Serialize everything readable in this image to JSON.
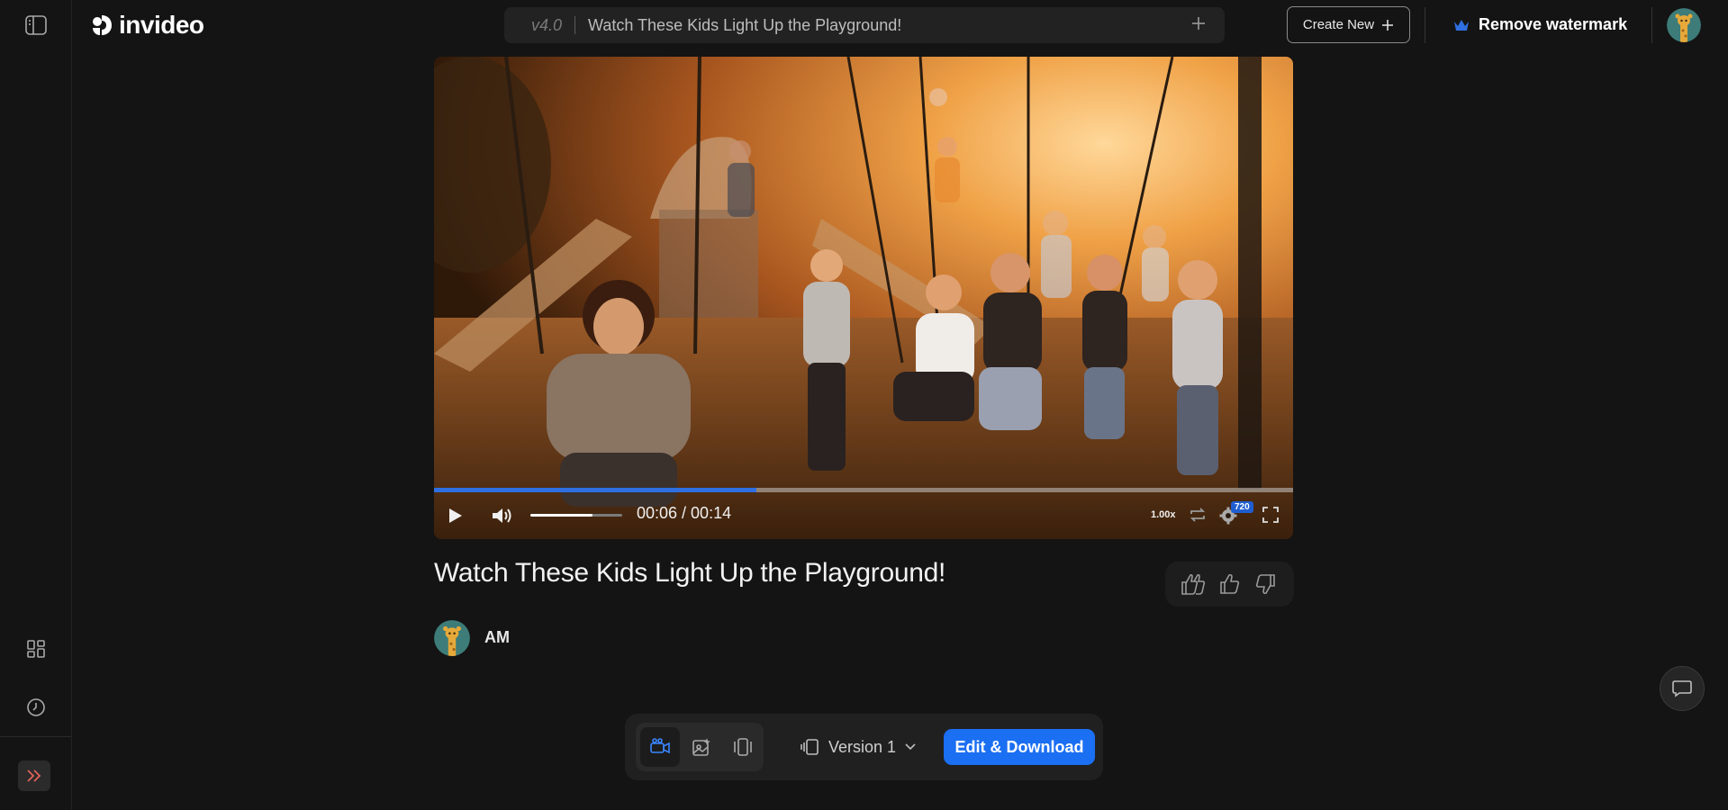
{
  "header": {
    "logo_text": "invideo",
    "version_label": "v4.0",
    "project_title": "Watch These Kids Light Up the Playground!",
    "create_new_label": "Create New",
    "remove_watermark_label": "Remove watermark"
  },
  "sidebar": {
    "items": [
      {
        "icon": "sidebar-toggle-icon"
      },
      {
        "icon": "dashboard-icon"
      },
      {
        "icon": "history-icon"
      },
      {
        "icon": "expand-chevrons-icon"
      }
    ]
  },
  "player": {
    "time_display": "00:06 / 00:14",
    "progress": 0.375,
    "volume": 0.68,
    "speed_label": "1.00x",
    "quality_badge": "720"
  },
  "video": {
    "title": "Watch These Kids Light Up the Playground!",
    "author": "AM"
  },
  "bottom_bar": {
    "version_label": "Version 1",
    "edit_download_label": "Edit & Download"
  },
  "colors": {
    "background": "#141414",
    "accent": "#1b6ff2",
    "progress": "#2f6fe0",
    "crown": "#2f6fe0"
  }
}
